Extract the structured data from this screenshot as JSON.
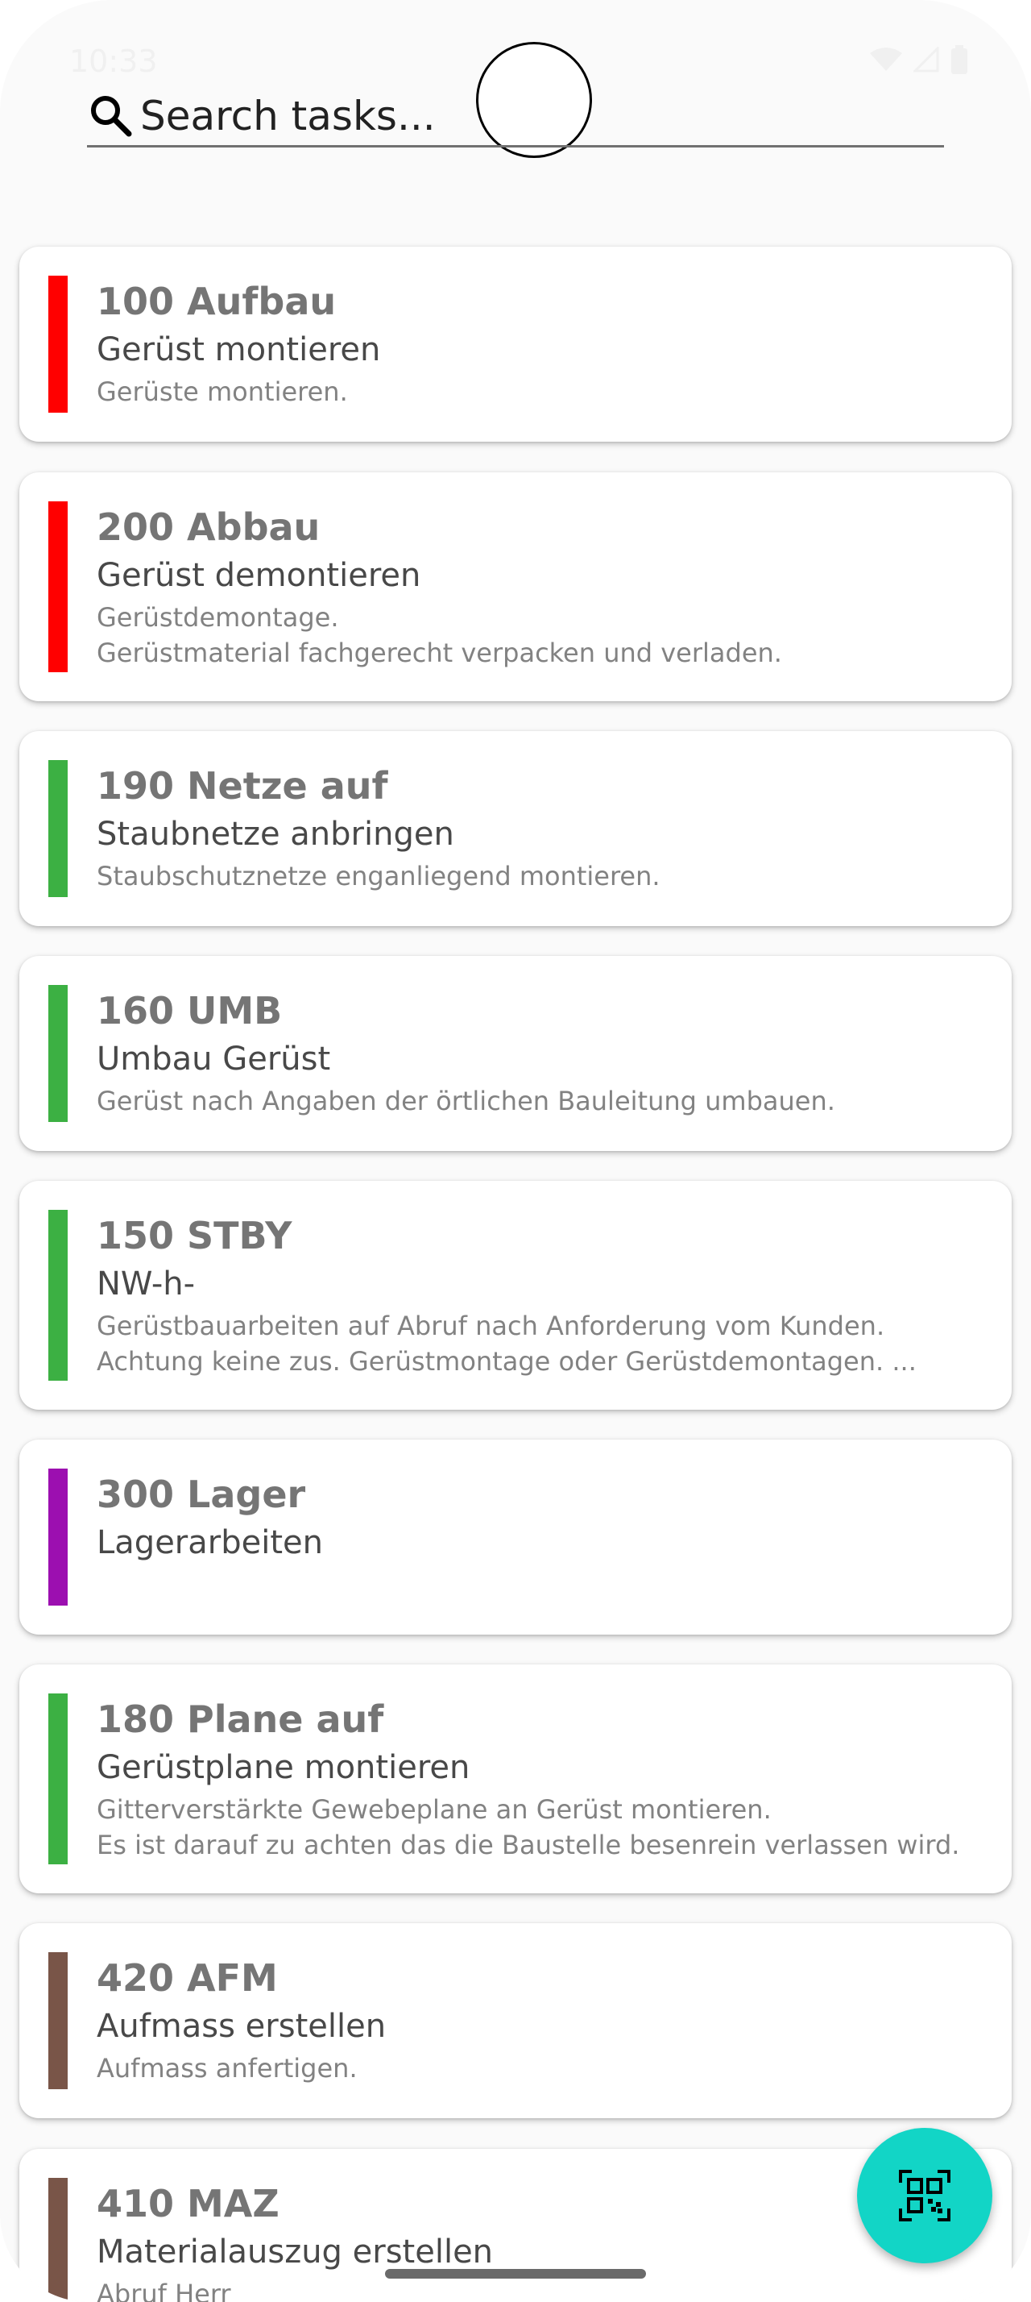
{
  "status_bar": {
    "time": "10:33"
  },
  "search": {
    "placeholder": "Search tasks..."
  },
  "tasks": [
    {
      "title": "100 Aufbau",
      "subtitle": "Gerüst montieren",
      "description": "Gerüste montieren.",
      "color": "#ff0000"
    },
    {
      "title": "200 Abbau",
      "subtitle": "Gerüst demontieren",
      "description": "Gerüstdemontage.\nGerüstmaterial fachgerecht verpacken und verladen.",
      "color": "#ff0000"
    },
    {
      "title": "190 Netze auf",
      "subtitle": "Staubnetze anbringen",
      "description": "Staubschutznetze enganliegend montieren.",
      "color": "#3cb043"
    },
    {
      "title": "160 UMB",
      "subtitle": "Umbau Gerüst",
      "description": "Gerüst nach Angaben der örtlichen Bauleitung umbauen.",
      "color": "#3cb043"
    },
    {
      "title": "150 STBY",
      "subtitle": "NW-h-",
      "description": "Gerüstbauarbeiten auf Abruf nach Anforderung vom Kunden.\nAchtung keine zus. Gerüstmontage oder Gerüstdemontagen. ...",
      "color": "#3cb043"
    },
    {
      "title": "300 Lager",
      "subtitle": "Lagerarbeiten",
      "description": "",
      "color": "#9c0fb0"
    },
    {
      "title": "180 Plane auf",
      "subtitle": "Gerüstplane montieren",
      "description": "Gitterverstärkte Gewebeplane an Gerüst montieren.\nEs ist darauf zu achten das die Baustelle besenrein verlassen wird.",
      "color": "#3cb043"
    },
    {
      "title": "420 AFM",
      "subtitle": "Aufmass erstellen",
      "description": "Aufmass anfertigen.",
      "color": "#795548"
    },
    {
      "title": "410 MAZ",
      "subtitle": "Materialauszug erstellen",
      "description": "Abruf Herr",
      "color": "#795548"
    }
  ],
  "fab": {
    "icon": "qr-code-scan-icon"
  }
}
